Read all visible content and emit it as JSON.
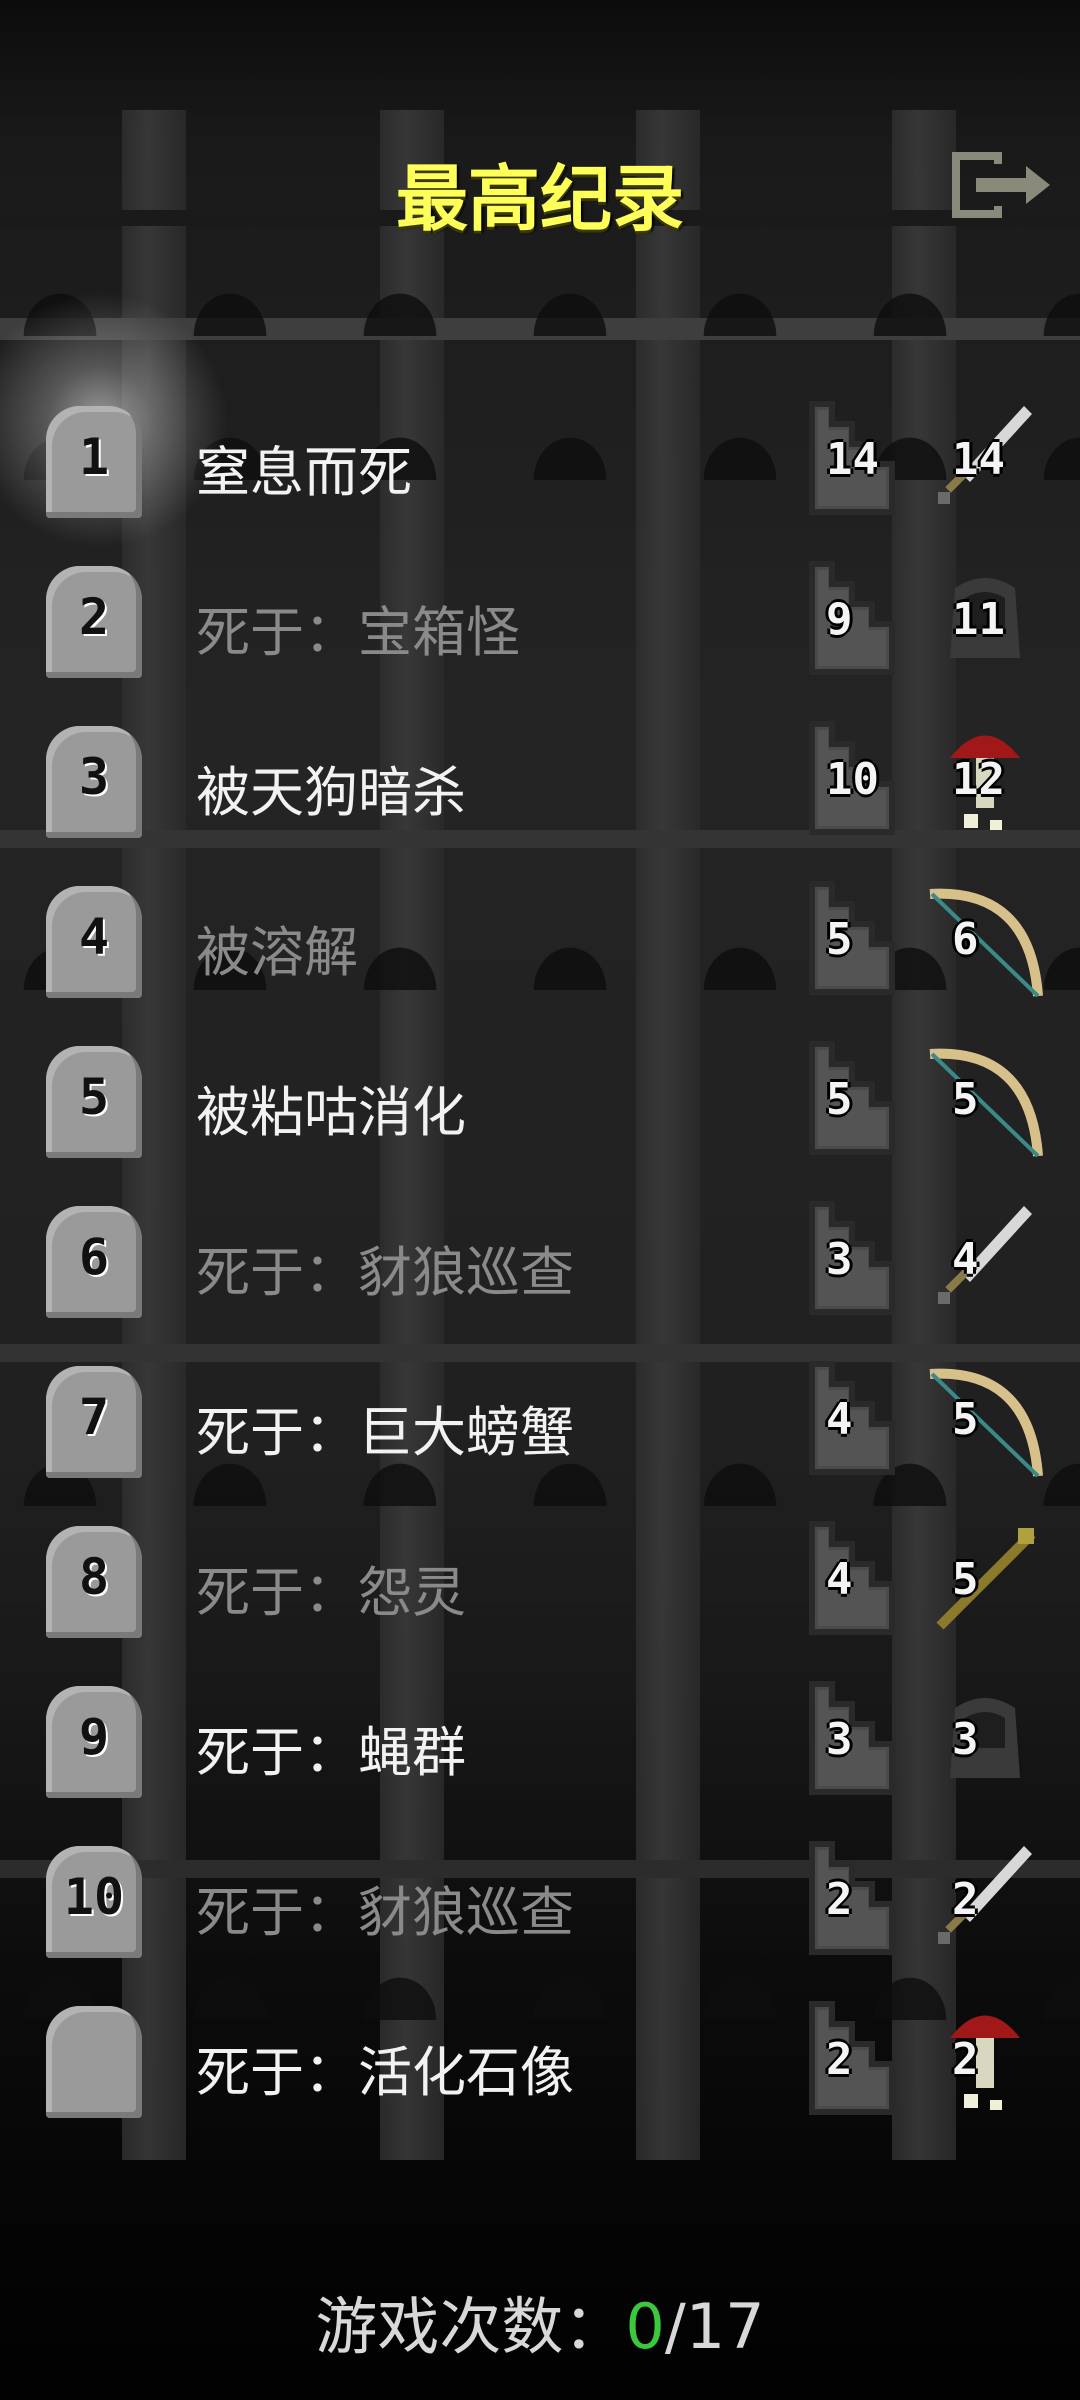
{
  "title": "最高纪录",
  "icons": {
    "exit": "exit-icon",
    "tombstone": "tombstone-icon",
    "depth": "stairs-icon"
  },
  "rows": [
    {
      "rank": "1",
      "cause": "窒息而死",
      "depth": "14",
      "level": "14",
      "hero": "sword-icon",
      "dim": false
    },
    {
      "rank": "2",
      "cause": "死于：宝箱怪",
      "depth": "9",
      "level": "11",
      "hero": "hood-icon",
      "dim": true
    },
    {
      "rank": "3",
      "cause": "被天狗暗杀",
      "depth": "10",
      "level": "12",
      "hero": "mushroom-icon",
      "dim": false
    },
    {
      "rank": "4",
      "cause": "被溶解",
      "depth": "5",
      "level": "6",
      "hero": "bow-icon",
      "dim": true
    },
    {
      "rank": "5",
      "cause": "被粘咕消化",
      "depth": "5",
      "level": "5",
      "hero": "bow-icon",
      "dim": false
    },
    {
      "rank": "6",
      "cause": "死于：豺狼巡查",
      "depth": "3",
      "level": "4",
      "hero": "sword-icon",
      "dim": true
    },
    {
      "rank": "7",
      "cause": "死于：巨大螃蟹",
      "depth": "4",
      "level": "5",
      "hero": "bow-icon",
      "dim": false
    },
    {
      "rank": "8",
      "cause": "死于：怨灵",
      "depth": "4",
      "level": "5",
      "hero": "staff-icon",
      "dim": true
    },
    {
      "rank": "9",
      "cause": "死于：蝇群",
      "depth": "3",
      "level": "3",
      "hero": "hood-icon",
      "dim": false
    },
    {
      "rank": "10",
      "cause": "死于：豺狼巡查",
      "depth": "2",
      "level": "2",
      "hero": "sword-icon",
      "dim": true
    },
    {
      "rank": "",
      "cause": "死于：活化石像",
      "depth": "2",
      "level": "2",
      "hero": "mushroom-icon",
      "dim": false
    }
  ],
  "footer": {
    "label": "游戏次数：",
    "won": "0",
    "total": "/17"
  },
  "colors": {
    "title": "#ffff5a",
    "accent_green": "#3cc83c"
  }
}
